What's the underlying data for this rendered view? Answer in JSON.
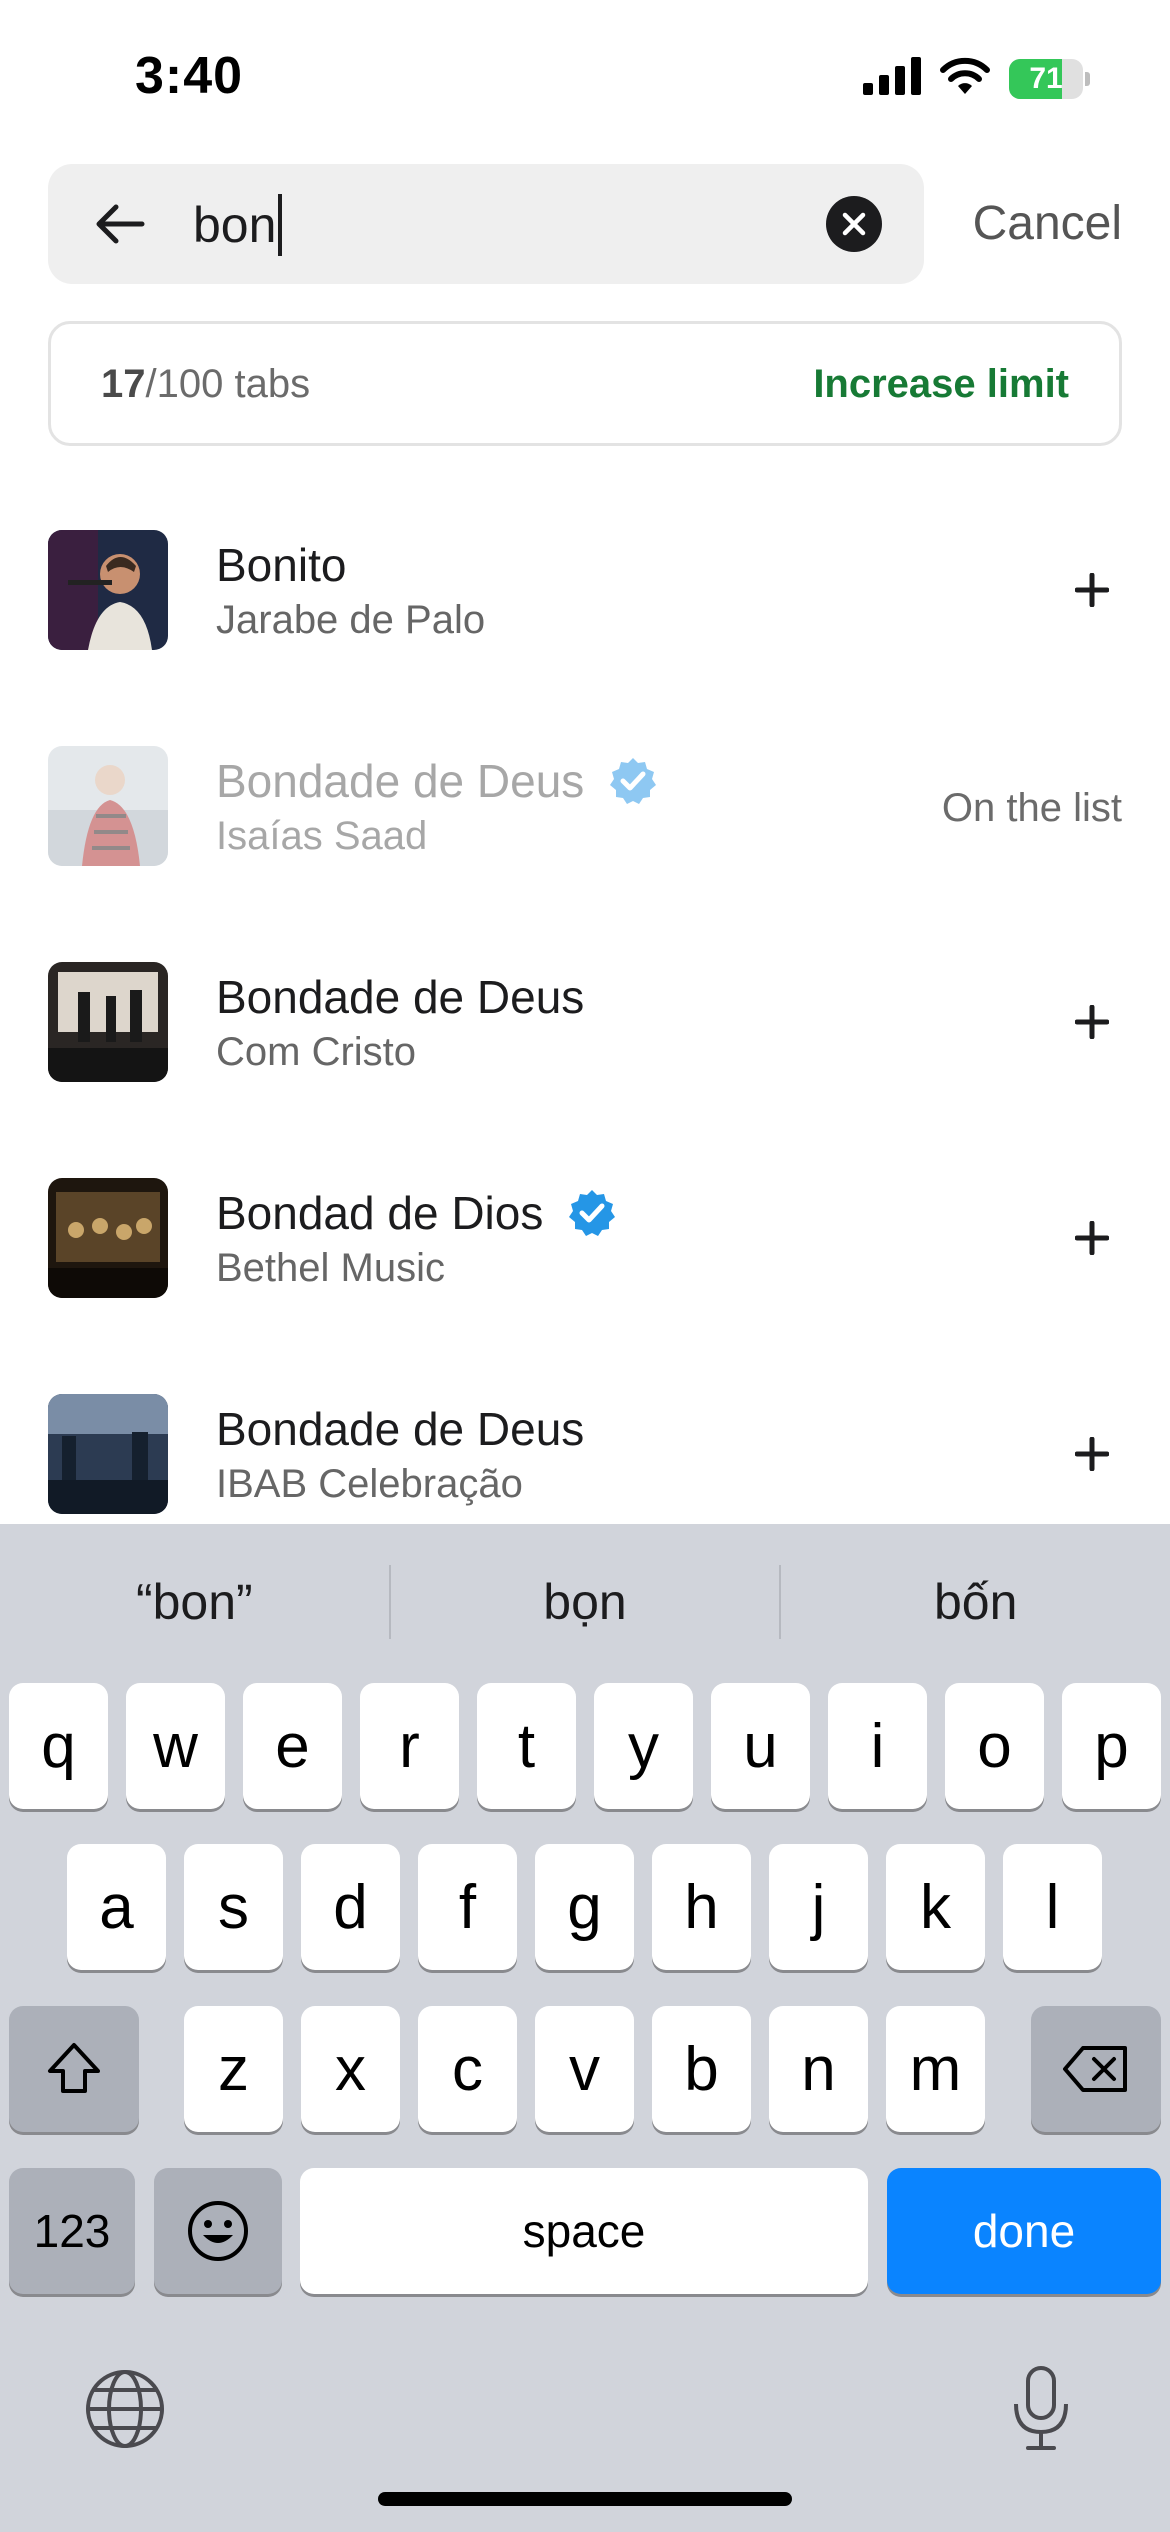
{
  "status_bar": {
    "time": "3:40",
    "battery_level": "71",
    "battery_fraction": 0.71,
    "battery_color": "#34c759",
    "icons": [
      "cellular-signal-icon",
      "wifi-icon",
      "battery-charging-icon"
    ]
  },
  "search": {
    "query": "bon",
    "back_icon": "arrow-left-icon",
    "clear_icon": "clear-circle-icon",
    "cancel_label": "Cancel"
  },
  "limit": {
    "used": "17",
    "total_label": "/100 tabs",
    "increase_label": "Increase limit",
    "accent_color": "#177a35"
  },
  "results": [
    {
      "title": "Bonito",
      "artist": "Jarabe de Palo",
      "verified": false,
      "status": "add",
      "action_icon": "plus-icon"
    },
    {
      "title": "Bondade de Deus",
      "artist": "Isaías Saad",
      "verified": true,
      "status": "On the list",
      "action_icon": ""
    },
    {
      "title": "Bondade de Deus",
      "artist": "Com Cristo",
      "verified": false,
      "status": "add",
      "action_icon": "plus-icon"
    },
    {
      "title": "Bondad de Dios",
      "artist": "Bethel Music",
      "verified": true,
      "status": "add",
      "action_icon": "plus-icon"
    },
    {
      "title": "Bondade de Deus",
      "artist": "IBAB Celebração",
      "verified": false,
      "status": "add",
      "action_icon": "plus-icon"
    }
  ],
  "keyboard": {
    "suggestions": [
      "“bon”",
      "bọn",
      "bốn"
    ],
    "row1": [
      "q",
      "w",
      "e",
      "r",
      "t",
      "y",
      "u",
      "i",
      "o",
      "p"
    ],
    "row2": [
      "a",
      "s",
      "d",
      "f",
      "g",
      "h",
      "j",
      "k",
      "l"
    ],
    "row3": [
      "z",
      "x",
      "c",
      "v",
      "b",
      "n",
      "m"
    ],
    "numbers_label": "123",
    "space_label": "space",
    "done_label": "done",
    "done_color": "#0a84ff",
    "icons": [
      "shift-icon",
      "delete-icon",
      "emoji-icon",
      "globe-icon",
      "microphone-icon"
    ]
  }
}
